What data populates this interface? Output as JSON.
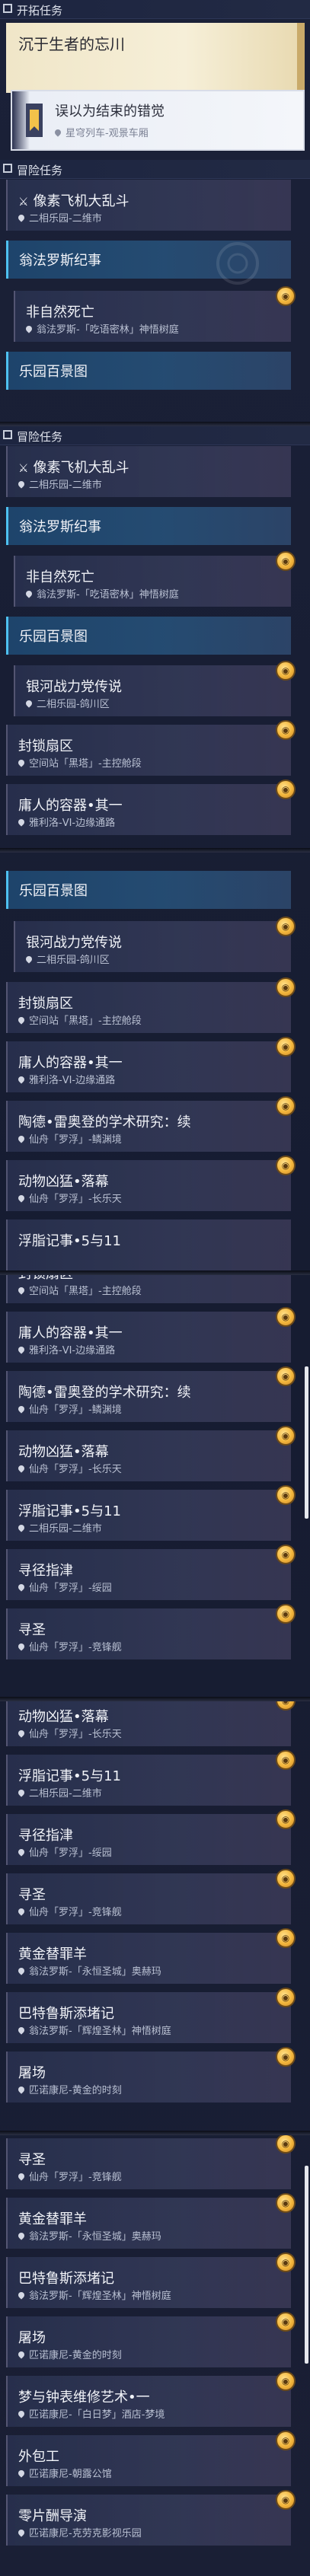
{
  "sections": {
    "trailblaze": "开拓任务",
    "adventure": "冒险任务"
  },
  "trailblaze_highlight": "沉于生者的忘川",
  "trailblaze_selected": {
    "title": "误以为结束的错觉",
    "location": "星穹列车-观景车厢"
  },
  "missions": {
    "pixel": {
      "title": "像素飞机大乱斗",
      "location": "二相乐园-二维市"
    },
    "ongphalos": {
      "title": "翁法罗斯纪事"
    },
    "unnatural": {
      "title": "非自然死亡",
      "location": "翁法罗斯-「吃语密林」神悟树庭"
    },
    "paradise": {
      "title": "乐园百景图"
    },
    "galaxy": {
      "title": "银河战力党传说",
      "location": "二相乐园-鸽川区"
    },
    "lockdown": {
      "title": "封锁扇区",
      "location": "空间站「黑塔」-主控舱段"
    },
    "tang": {
      "title": "庸人的容器•其一",
      "location": "雅利洛-VI-边缘通路"
    },
    "taode": {
      "title": "陶德•雷奥登的学术研究：续",
      "location": "仙舟「罗浮」-鳞渊境"
    },
    "animal": {
      "title": "动物凶猛•落幕",
      "location": "仙舟「罗浮」-长乐天"
    },
    "floating": {
      "title": "浮脂记事•5与11",
      "location": "二相乐园-二维市"
    },
    "needle": {
      "title": "寻径指津",
      "location": "仙舟「罗浮」-绥园"
    },
    "xunsheng": {
      "title": "寻圣",
      "location": "仙舟「罗浮」-竞锋舰"
    },
    "golden": {
      "title": "黄金替罪羊",
      "location": "翁法罗斯-「永恒圣城」奥赫玛"
    },
    "batulus": {
      "title": "巴特鲁斯添堵记",
      "location": "翁法罗斯-「辉煌圣林」神悟树庭"
    },
    "tuchang": {
      "title": "屠场",
      "location": "匹诺康尼-黄金的时刻"
    },
    "dream": {
      "title": "梦与钟表维修艺术•一",
      "location": "匹诺康尼-「白日梦」酒店-梦境"
    },
    "outsource": {
      "title": "外包工",
      "location": "匹诺康尼-朝露公馆"
    },
    "zero": {
      "title": "零片酬导演",
      "location": "匹诺康尼-克劳克影视乐园"
    }
  }
}
